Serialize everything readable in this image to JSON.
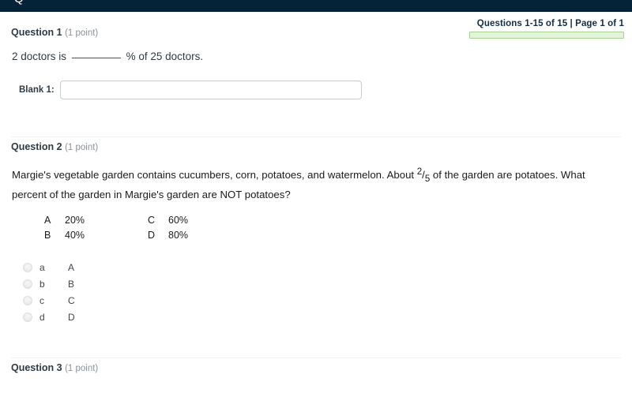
{
  "topbar": {
    "glyph": "Q"
  },
  "pager": {
    "text": "Questions 1-15 of 15 | Page 1 of 1",
    "progress_percent": 100,
    "bar_fill_color": "#e2f3d9",
    "bar_border_color": "#a9d395"
  },
  "questions": [
    {
      "title": "Question 1",
      "points": "(1 point)",
      "type": "fill-in-the-blank",
      "text_before": "2 doctors is",
      "text_after": "% of 25 doctors.",
      "blank_label": "Blank 1:",
      "blank_value": "",
      "blank_placeholder": ""
    },
    {
      "title": "Question 2",
      "points": "(1 point)",
      "type": "multiple-choice",
      "text_part1": "Margie's vegetable garden contains cucumbers, corn, potatoes, and watermelon.  About",
      "fraction_numerator": "2",
      "fraction_denominator": "5",
      "text_part2": "of the garden are potatoes.  What percent of the garden in Margie's garden are NOT potatoes?",
      "choice_table": [
        [
          {
            "letter": "A",
            "value": "20%"
          },
          {
            "letter": "C",
            "value": "60%"
          }
        ],
        [
          {
            "letter": "B",
            "value": "40%"
          },
          {
            "letter": "D",
            "value": "80%"
          }
        ]
      ],
      "answers": [
        {
          "key": "a",
          "value": "A",
          "selected": false
        },
        {
          "key": "b",
          "value": "B",
          "selected": false
        },
        {
          "key": "c",
          "value": "C",
          "selected": false
        },
        {
          "key": "d",
          "value": "D",
          "selected": false
        }
      ]
    },
    {
      "title": "Question 3",
      "points": "(1 point)"
    }
  ],
  "colors": {
    "topbar": "#042338",
    "text": "#2d3b45",
    "muted": "#8b9299",
    "body_text": "#1a1a1a"
  }
}
